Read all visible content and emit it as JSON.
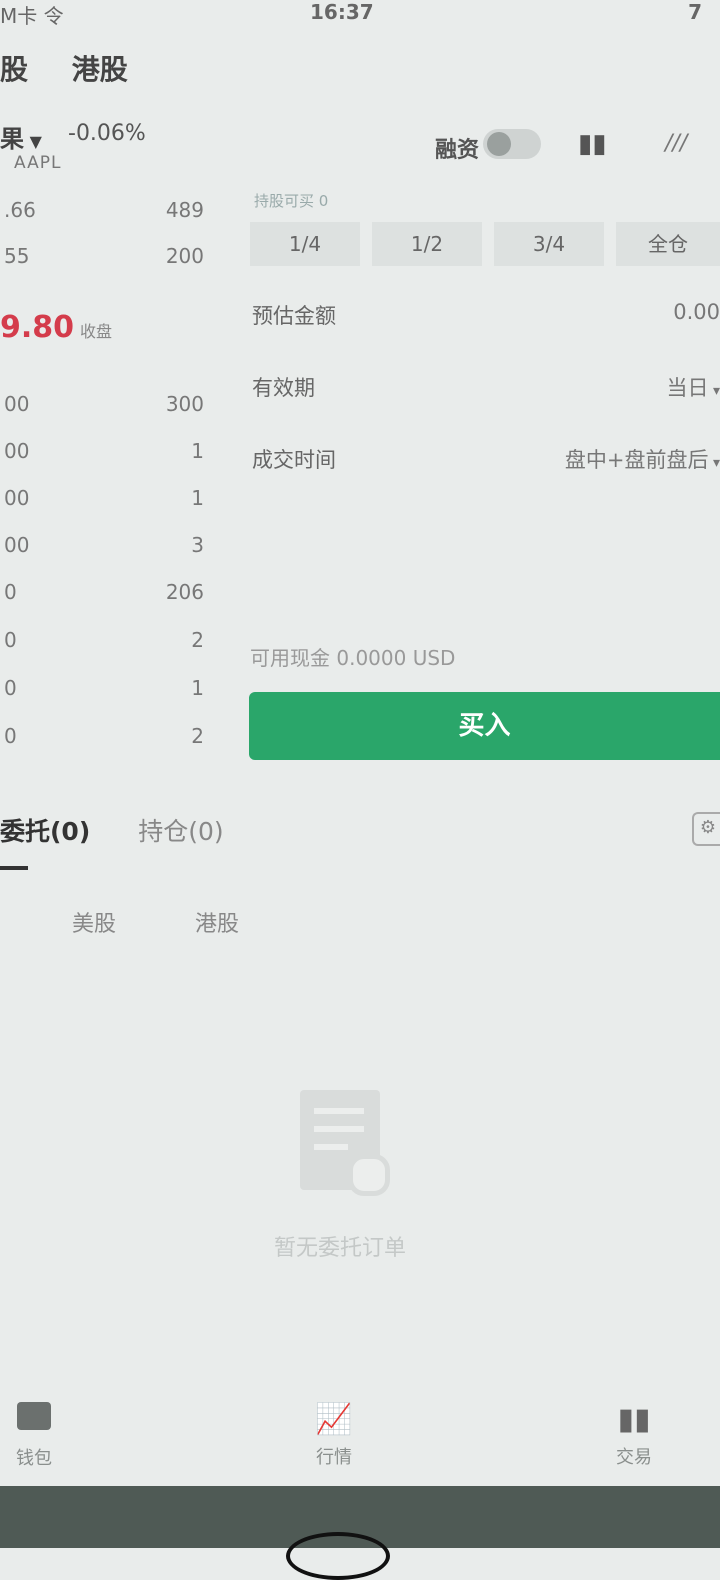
{
  "status_bar": {
    "carrier": "M卡 令",
    "time": "16:37",
    "battery": "7"
  },
  "market_tabs": [
    "股",
    "港股"
  ],
  "stock": {
    "name": "果",
    "change": "-0.06%",
    "symbol": "AAPL",
    "margin_label": "融资"
  },
  "order_book": {
    "asks": [
      {
        "price": ".66",
        "qty": "489"
      },
      {
        "price": "55",
        "qty": "200"
      }
    ],
    "last_price": "9.80",
    "last_price_tag": "收盘",
    "bids": [
      {
        "price": "00",
        "qty": "300"
      },
      {
        "price": "00",
        "qty": "1"
      },
      {
        "price": "00",
        "qty": "1"
      },
      {
        "price": "00",
        "qty": "3"
      },
      {
        "price": "0",
        "qty": "206"
      },
      {
        "price": "0",
        "qty": "2"
      },
      {
        "price": "0",
        "qty": "1"
      },
      {
        "price": "0",
        "qty": "2"
      }
    ]
  },
  "order_form": {
    "ratio_title": "持股可买 0",
    "ratios": [
      "1/4",
      "1/2",
      "3/4",
      "全仓"
    ],
    "estimated_label": "预估金额",
    "estimated_value": "0.00",
    "validity_label": "有效期",
    "validity_value": "当日",
    "trade_time_label": "成交时间",
    "trade_time_value": "盘中+盘前盘后",
    "cash_text": "可用现金 0.0000 USD",
    "buy_label": "买入"
  },
  "orders_tabs": [
    {
      "label": "委托(0)",
      "active": true
    },
    {
      "label": "持仓(0)",
      "active": false
    }
  ],
  "sub_tabs": [
    "美股",
    "港股"
  ],
  "empty_text": "暂无委托订单",
  "bottom_nav": [
    {
      "label": "钱包",
      "icon": "wallet-icon"
    },
    {
      "label": "行情",
      "icon": "chart-icon"
    },
    {
      "label": "交易",
      "icon": "trade-icon"
    }
  ]
}
